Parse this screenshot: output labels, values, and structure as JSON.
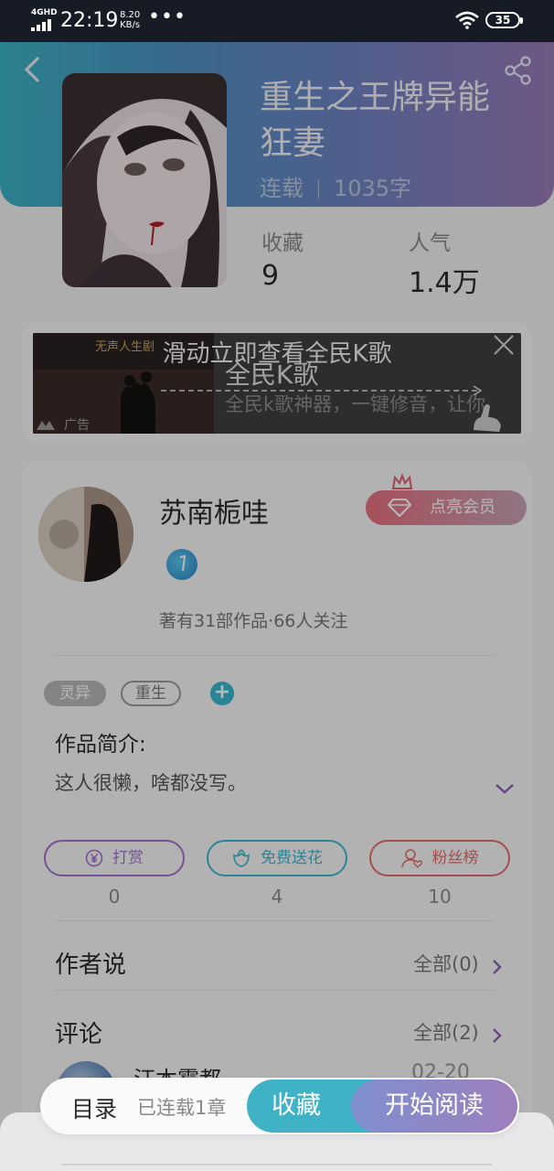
{
  "status_bar": {
    "network": "4GHD",
    "time": "22:19",
    "speed_value": "8.20",
    "speed_unit": "KB/s",
    "more": "•••",
    "battery": "35"
  },
  "book": {
    "title": "重生之王牌异能狂妻",
    "status": "连载",
    "word_count": "1035字",
    "stats": [
      {
        "label": "收藏",
        "value": "9"
      },
      {
        "label": "人气",
        "value": "1.4万"
      }
    ]
  },
  "ad": {
    "overlay_text": "滑动立即查看全民K歌",
    "app_name": "全民K歌",
    "description": "全民k歌神器，一键修音，让你",
    "image_caption": "无声人生剧",
    "label": "广告"
  },
  "author": {
    "name": "苏南栀哇",
    "vip_button": "点亮会员",
    "meta": "著有31部作品·66人关注"
  },
  "tags": [
    "灵异",
    "重生"
  ],
  "add_tag": "+",
  "intro": {
    "title": "作品简介:",
    "text": "这人很懒，啥都没写。"
  },
  "actions": [
    {
      "label": "打赏",
      "count": "0",
      "color": "#a46fcf",
      "icon": "coin-icon"
    },
    {
      "label": "免费送花",
      "count": "4",
      "color": "#3fb8cc",
      "icon": "flower-icon"
    },
    {
      "label": "粉丝榜",
      "count": "10",
      "color": "#e46c6c",
      "icon": "fans-icon"
    }
  ],
  "author_says": {
    "title": "作者说",
    "link": "全部(0)"
  },
  "comments": {
    "title": "评论",
    "link": "全部(2)",
    "first_user": "汪本霉都",
    "first_date": "02-20"
  },
  "bottom_bar": {
    "toc": "目录",
    "serial_info": "已连载1章",
    "collect": "收藏",
    "read": "开始阅读"
  },
  "colors": {
    "accent_teal": "#3fb2c5",
    "accent_purple": "#9d7fbc",
    "vip_pink": "#e8707e"
  }
}
